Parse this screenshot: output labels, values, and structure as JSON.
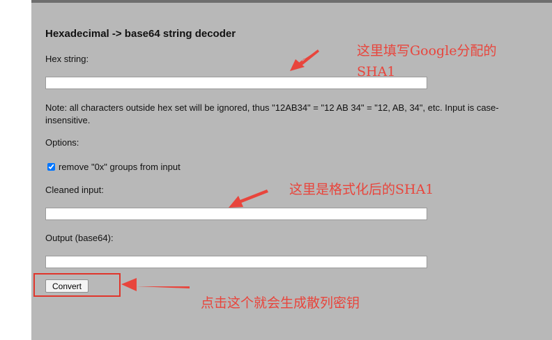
{
  "form": {
    "title": "Hexadecimal -> base64 string decoder",
    "hex_label": "Hex string:",
    "hex_value": "",
    "note": "Note: all characters outside hex set will be ignored, thus \"12AB34\" = \"12 AB 34\" = \"12, AB, 34\", etc. Input is case-insensitive.",
    "options_label": "Options:",
    "remove_0x_label": "remove \"0x\" groups from input",
    "remove_0x_checked": true,
    "cleaned_label": "Cleaned input:",
    "cleaned_value": "",
    "output_label": "Output (base64):",
    "output_value": "",
    "convert_label": "Convert"
  },
  "annotations": {
    "hex_note_line1": "这里填写Google分配的",
    "hex_note_line2": "SHA1",
    "cleaned_note": "这里是格式化后的SHA1",
    "convert_note": "点击这个就会生成散列密钥",
    "color": "#e8453c"
  }
}
